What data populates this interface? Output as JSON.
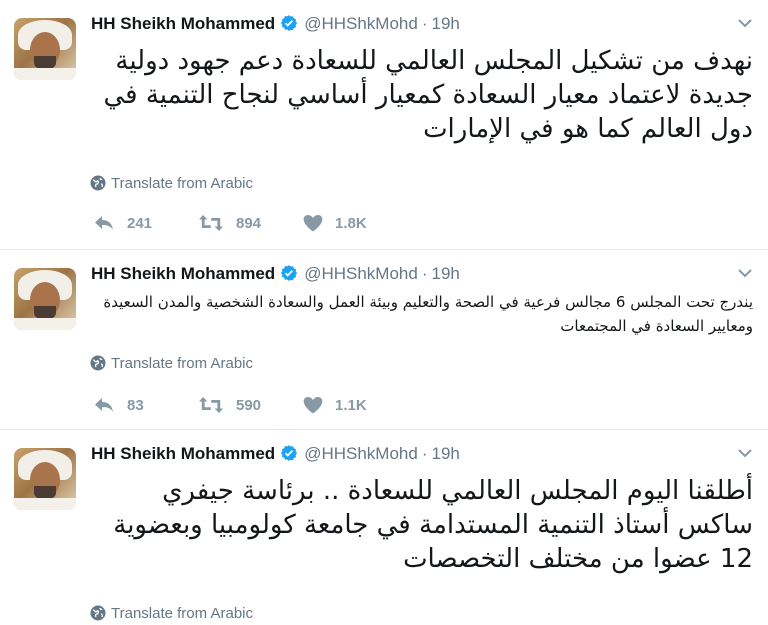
{
  "tweets": [
    {
      "author_name": "HH Sheikh Mohammed",
      "handle": "@HHShkMohd",
      "separator": "·",
      "time": "19h",
      "text": "نهدف من تشكيل المجلس العالمي للسعادة دعم جهود دولية جديدة لاعتماد معيار السعادة كمعيار أساسي لنجاح التنمية في دول العالم كما هو في الإمارات",
      "translate_label": "Translate from Arabic",
      "replies": "241",
      "retweets": "894",
      "likes": "1.8K"
    },
    {
      "author_name": "HH Sheikh Mohammed",
      "handle": "@HHShkMohd",
      "separator": "·",
      "time": "19h",
      "text": "يندرج تحت المجلس 6 مجالس فرعية في الصحة والتعليم وبيئة العمل والسعادة الشخصية والمدن السعيدة ومعايير السعادة في المجتمعات",
      "translate_label": "Translate from Arabic",
      "replies": "83",
      "retweets": "590",
      "likes": "1.1K"
    },
    {
      "author_name": "HH Sheikh Mohammed",
      "handle": "@HHShkMohd",
      "separator": "·",
      "time": "19h",
      "text": "أطلقنا اليوم المجلس العالمي للسعادة .. برئاسة جيفري ساكس أستاذ التنمية المستدامة في جامعة كولومبيا وبعضوية 12 عضوا من مختلف التخصصات",
      "translate_label": "Translate from Arabic"
    }
  ],
  "colors": {
    "verified": "#1da1f2",
    "secondary_text": "#657786",
    "action_gray": "#8899a6",
    "divider": "#e6ecf0"
  },
  "icons": [
    "verified-badge-icon",
    "chevron-down-icon",
    "globe-icon",
    "reply-icon",
    "retweet-icon",
    "like-icon"
  ]
}
